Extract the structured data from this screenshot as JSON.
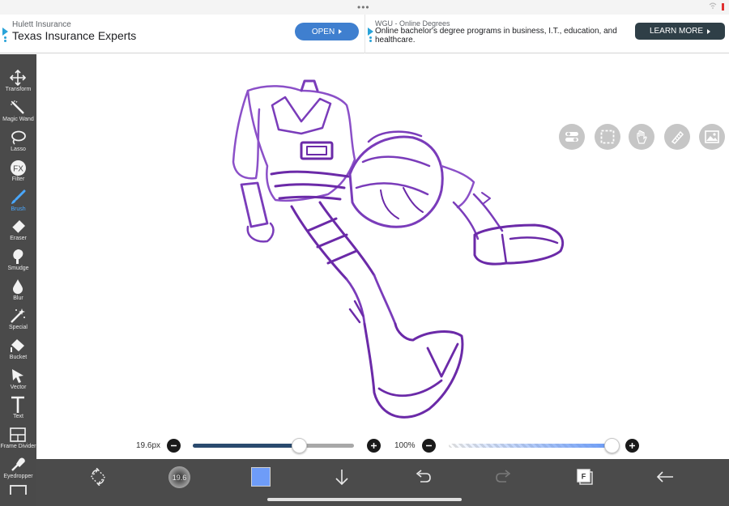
{
  "ads": {
    "left": {
      "sponsor": "Hulett Insurance",
      "headline": "Texas Insurance Experts",
      "cta": "OPEN"
    },
    "right": {
      "sponsor": "WGU - Online Degrees",
      "description": "Online bachelor's degree programs in business, I.T., education, and healthcare.",
      "cta": "LEARN MORE"
    }
  },
  "toolbar": {
    "active": "Brush",
    "tools": [
      {
        "label": "Transform",
        "icon": "move-arrows-icon"
      },
      {
        "label": "Magic Wand",
        "icon": "magic-wand-icon"
      },
      {
        "label": "Lasso",
        "icon": "lasso-icon"
      },
      {
        "label": "Filter",
        "icon": "fx-icon"
      },
      {
        "label": "Brush",
        "icon": "brush-icon"
      },
      {
        "label": "Eraser",
        "icon": "eraser-icon"
      },
      {
        "label": "Smudge",
        "icon": "smudge-icon"
      },
      {
        "label": "Blur",
        "icon": "drop-icon"
      },
      {
        "label": "Special",
        "icon": "sparkle-icon"
      },
      {
        "label": "Bucket",
        "icon": "bucket-icon"
      },
      {
        "label": "Vector",
        "icon": "cursor-arrow-icon"
      },
      {
        "label": "Text",
        "icon": "text-t-icon"
      },
      {
        "label": "Frame Divider",
        "icon": "frame-divider-icon"
      },
      {
        "label": "Eyedropper",
        "icon": "eyedropper-icon"
      }
    ]
  },
  "brush": {
    "size_label": "19.6px",
    "size_fraction": 0.66,
    "opacity_label": "100%",
    "opacity_fraction": 1.0,
    "preview_label": "19.6"
  },
  "colors": {
    "active_color": "#6e9cf8",
    "stroke_color": "#7b2fb5",
    "size_track_fill": "#2a4a6e",
    "opacity_track_fill": "#6a9af5",
    "accent": "#4aa8ff"
  },
  "quick_tools": [
    "toggle-icon",
    "selection-icon",
    "hand-icon",
    "ruler-icon",
    "image-icon"
  ],
  "bottom_bar": [
    "rotate-icon",
    "brush-preview",
    "color-swatch",
    "download-arrow-icon",
    "undo-icon",
    "redo-icon",
    "layers-icon",
    "back-arrow-icon"
  ]
}
